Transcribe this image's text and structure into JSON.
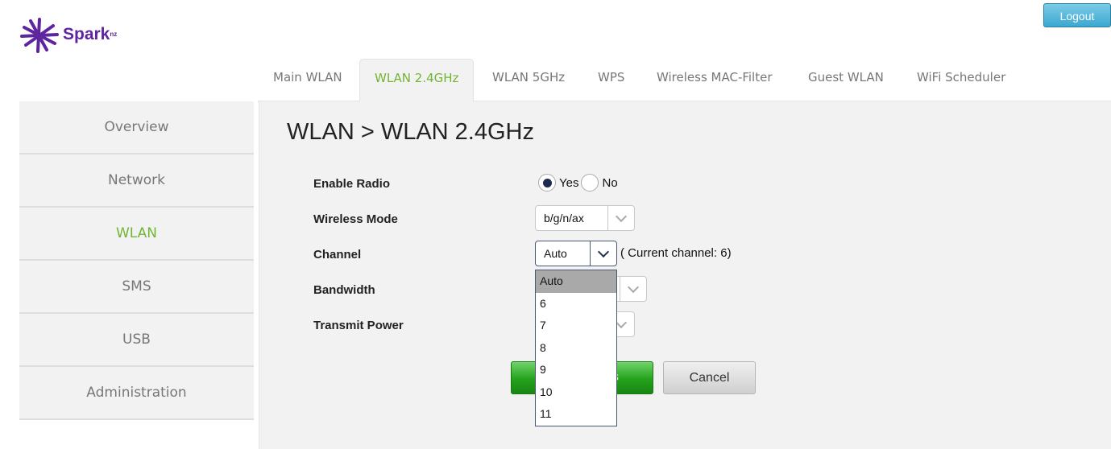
{
  "brand": {
    "name": "Spark",
    "suffix": "nz",
    "color": "#5f259f"
  },
  "header": {
    "logout_label": "Logout"
  },
  "tabs": [
    {
      "label": "Main WLAN",
      "active": false
    },
    {
      "label": "WLAN 2.4GHz",
      "active": true
    },
    {
      "label": "WLAN 5GHz",
      "active": false
    },
    {
      "label": "WPS",
      "active": false
    },
    {
      "label": "Wireless MAC-Filter",
      "active": false
    },
    {
      "label": "Guest WLAN",
      "active": false
    },
    {
      "label": "WiFi Scheduler",
      "active": false
    }
  ],
  "sidebar": {
    "items": [
      {
        "label": "Overview",
        "active": false
      },
      {
        "label": "Network",
        "active": false
      },
      {
        "label": "WLAN",
        "active": true
      },
      {
        "label": "SMS",
        "active": false
      },
      {
        "label": "USB",
        "active": false
      },
      {
        "label": "Administration",
        "active": false
      }
    ]
  },
  "main": {
    "title": "WLAN > WLAN 2.4GHz",
    "form": {
      "enable_radio": {
        "label": "Enable Radio",
        "options": [
          "Yes",
          "No"
        ],
        "selected": "Yes"
      },
      "wireless_mode": {
        "label": "Wireless Mode",
        "value": "b/g/n/ax"
      },
      "channel": {
        "label": "Channel",
        "value": "Auto",
        "current_channel_text": "( Current channel: 6)",
        "dropdown_open": true,
        "options": [
          "Auto",
          "6",
          "7",
          "8",
          "9",
          "10",
          "11"
        ],
        "highlighted": "Auto"
      },
      "bandwidth": {
        "label": "Bandwidth"
      },
      "transmit_power": {
        "label": "Transmit Power"
      }
    },
    "buttons": {
      "save_visible_fragment": "s",
      "cancel": "Cancel"
    }
  },
  "colors": {
    "accent_green": "#71b535",
    "logout_blue": "#3ba8d1",
    "save_green": "#24a21c"
  }
}
